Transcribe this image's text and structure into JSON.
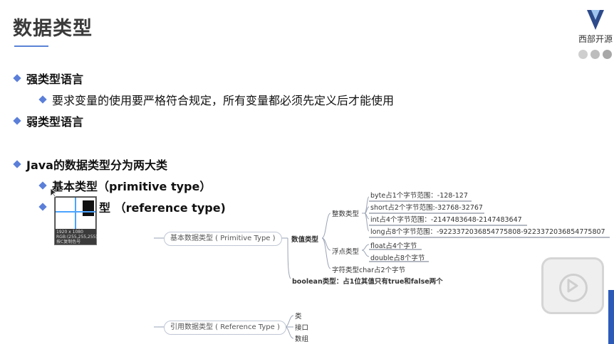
{
  "slide": {
    "title": "数据类型",
    "logo_text": "西部开源",
    "accent_color": "#5b7fd9"
  },
  "bullets": {
    "strong_typed": "强类型语言",
    "strong_typed_sub": "要求变量的使用要严格符合规定，所有变量都必须先定义后才能使用",
    "weak_typed": "弱类型语言",
    "java_types": "Java的数据类型分为两大类",
    "primitive": "基本类型（primitive type）",
    "reference_partial": "型 （reference type)"
  },
  "color_picker": {
    "resolution": "1920 x 1080",
    "rgb": "RGB:(255,255,255)",
    "hint": "按C复制色号"
  },
  "mindmap": {
    "primitive_node": "基本数据类型 ( Primitive Type )",
    "numeric": "数值类型",
    "integer": "整数类型",
    "byte": "byte占1个字节范围：-128-127",
    "short": "short占2个字节范围:-32768-32767",
    "int": "int占4个字节范围：-2147483648-2147483647",
    "long": "long占8个字节范围：-9223372036854775808-9223372036854775807",
    "float_type": "浮点类型",
    "float": "float占4个字节",
    "double": "double占8个字节",
    "char": "字符类型char占2个字节",
    "boolean": "boolean类型：占1位其值只有true和false两个",
    "reference_node": "引用数据类型 ( Reference Type )",
    "class": "类",
    "interface": "接口",
    "array": "数组"
  }
}
